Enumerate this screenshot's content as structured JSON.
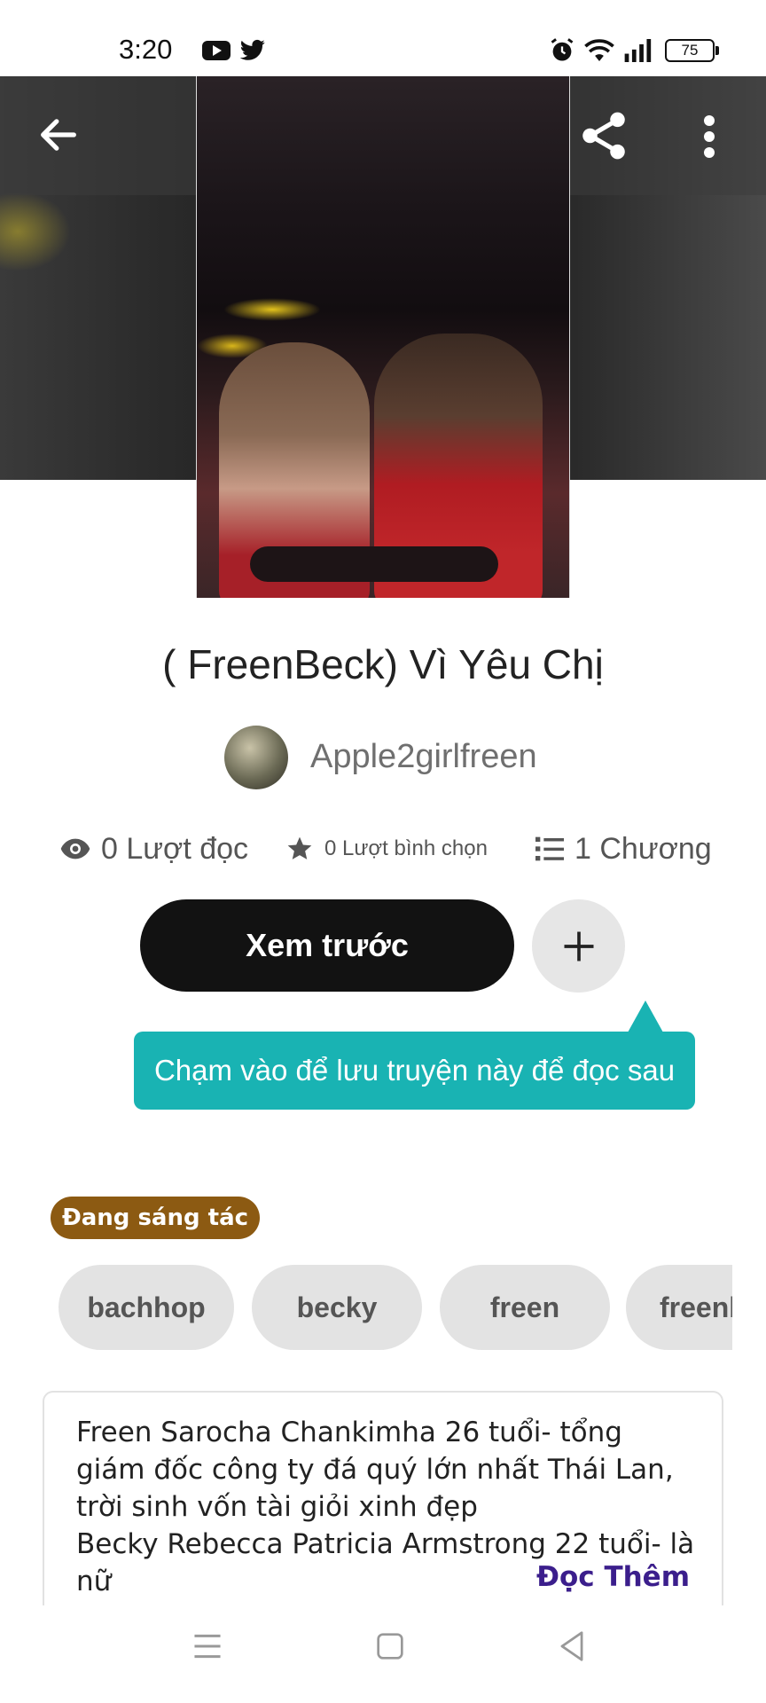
{
  "status_bar": {
    "time": "3:20",
    "battery": "75",
    "icons": [
      "youtube-icon",
      "twitter-icon",
      "alarm-icon",
      "wifi-icon",
      "signal-icon",
      "battery-icon"
    ]
  },
  "header": {
    "icons": [
      "back-arrow-icon",
      "share-icon",
      "more-vert-icon"
    ]
  },
  "story": {
    "title": "( FreenBeck) Vì Yêu Chị",
    "author": "Apple2girlfreen"
  },
  "stats": {
    "reads": "0 Lượt đọc",
    "votes": "0 Lượt bình chọn",
    "chapters": "1 Chương"
  },
  "actions": {
    "preview_label": "Xem trước",
    "add_icon": "plus-icon"
  },
  "tooltip": {
    "text": "Chạm vào để lưu truyện này để đọc sau"
  },
  "status_badge": "Đang sáng tác",
  "tags": [
    "bachhop",
    "becky",
    "freen",
    "freenb"
  ],
  "description": {
    "text": "Freen Sarocha Chankimha 26 tuổi- tổng giám đốc công ty đá quý lớn nhất Thái Lan, trời sinh vốn tài giỏi xinh đẹp\nBecky Rebecca Patricia Armstrong 22 tuổi- là nữ",
    "read_more": "Đọc Thêm"
  },
  "nav_bar": {
    "icons": [
      "menu-icon",
      "home-square-icon",
      "back-triangle-icon"
    ]
  },
  "colors": {
    "tooltip": "#19b3b3",
    "badge": "#8c5a12",
    "read_more": "#3b1e8c",
    "primary_button": "#121212"
  }
}
